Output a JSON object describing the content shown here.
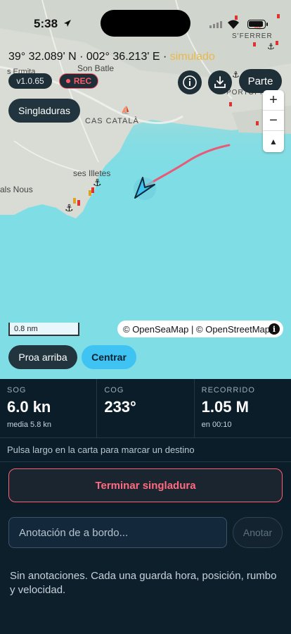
{
  "status_bar": {
    "time": "5:38"
  },
  "map": {
    "position": {
      "lat": "39° 32.089' N",
      "sep": " · ",
      "lon": "002° 36.213' E",
      "sep2": " · ",
      "mode": "simulado"
    },
    "version": "v1.0.65",
    "rec_label": "REC",
    "parte_label": "Parte",
    "singladuras_label": "Singladuras",
    "zoom": {
      "in": "+",
      "out": "−",
      "north": "▲"
    },
    "places": {
      "son_batle": "Son Batle",
      "cas_catala": "CAS CATALÀ",
      "illetes": "ses Illetes",
      "nous": "als Nous",
      "portopi": "PORTOPÍ",
      "ferrer": "S'FERRER",
      "ermita": "s Ermita"
    },
    "scale_label": "0.8 nm",
    "attribution": "© OpenSeaMap | © OpenStreetMap",
    "proa_label": "Proa arriba",
    "centrar_label": "Centrar"
  },
  "stats": [
    {
      "label": "SOG",
      "value": "6.0 kn",
      "sub": "media 5.8 kn"
    },
    {
      "label": "COG",
      "value": "233°",
      "sub": ""
    },
    {
      "label": "RECORRIDO",
      "value": "1.05 M",
      "sub": "en 00:10"
    }
  ],
  "hint": "Pulsa largo en la carta para marcar un destino",
  "end_label": "Terminar singladura",
  "note": {
    "placeholder": "Anotación de a bordo...",
    "button": "Anotar"
  },
  "empty_text": "Sin anotaciones. Cada una guarda hora, posición, rumbo y velocidad.",
  "colors": {
    "accent": "#3ec3f2",
    "danger": "#ff5f73",
    "track": "#e85a78",
    "simulated": "#e9b84a"
  }
}
